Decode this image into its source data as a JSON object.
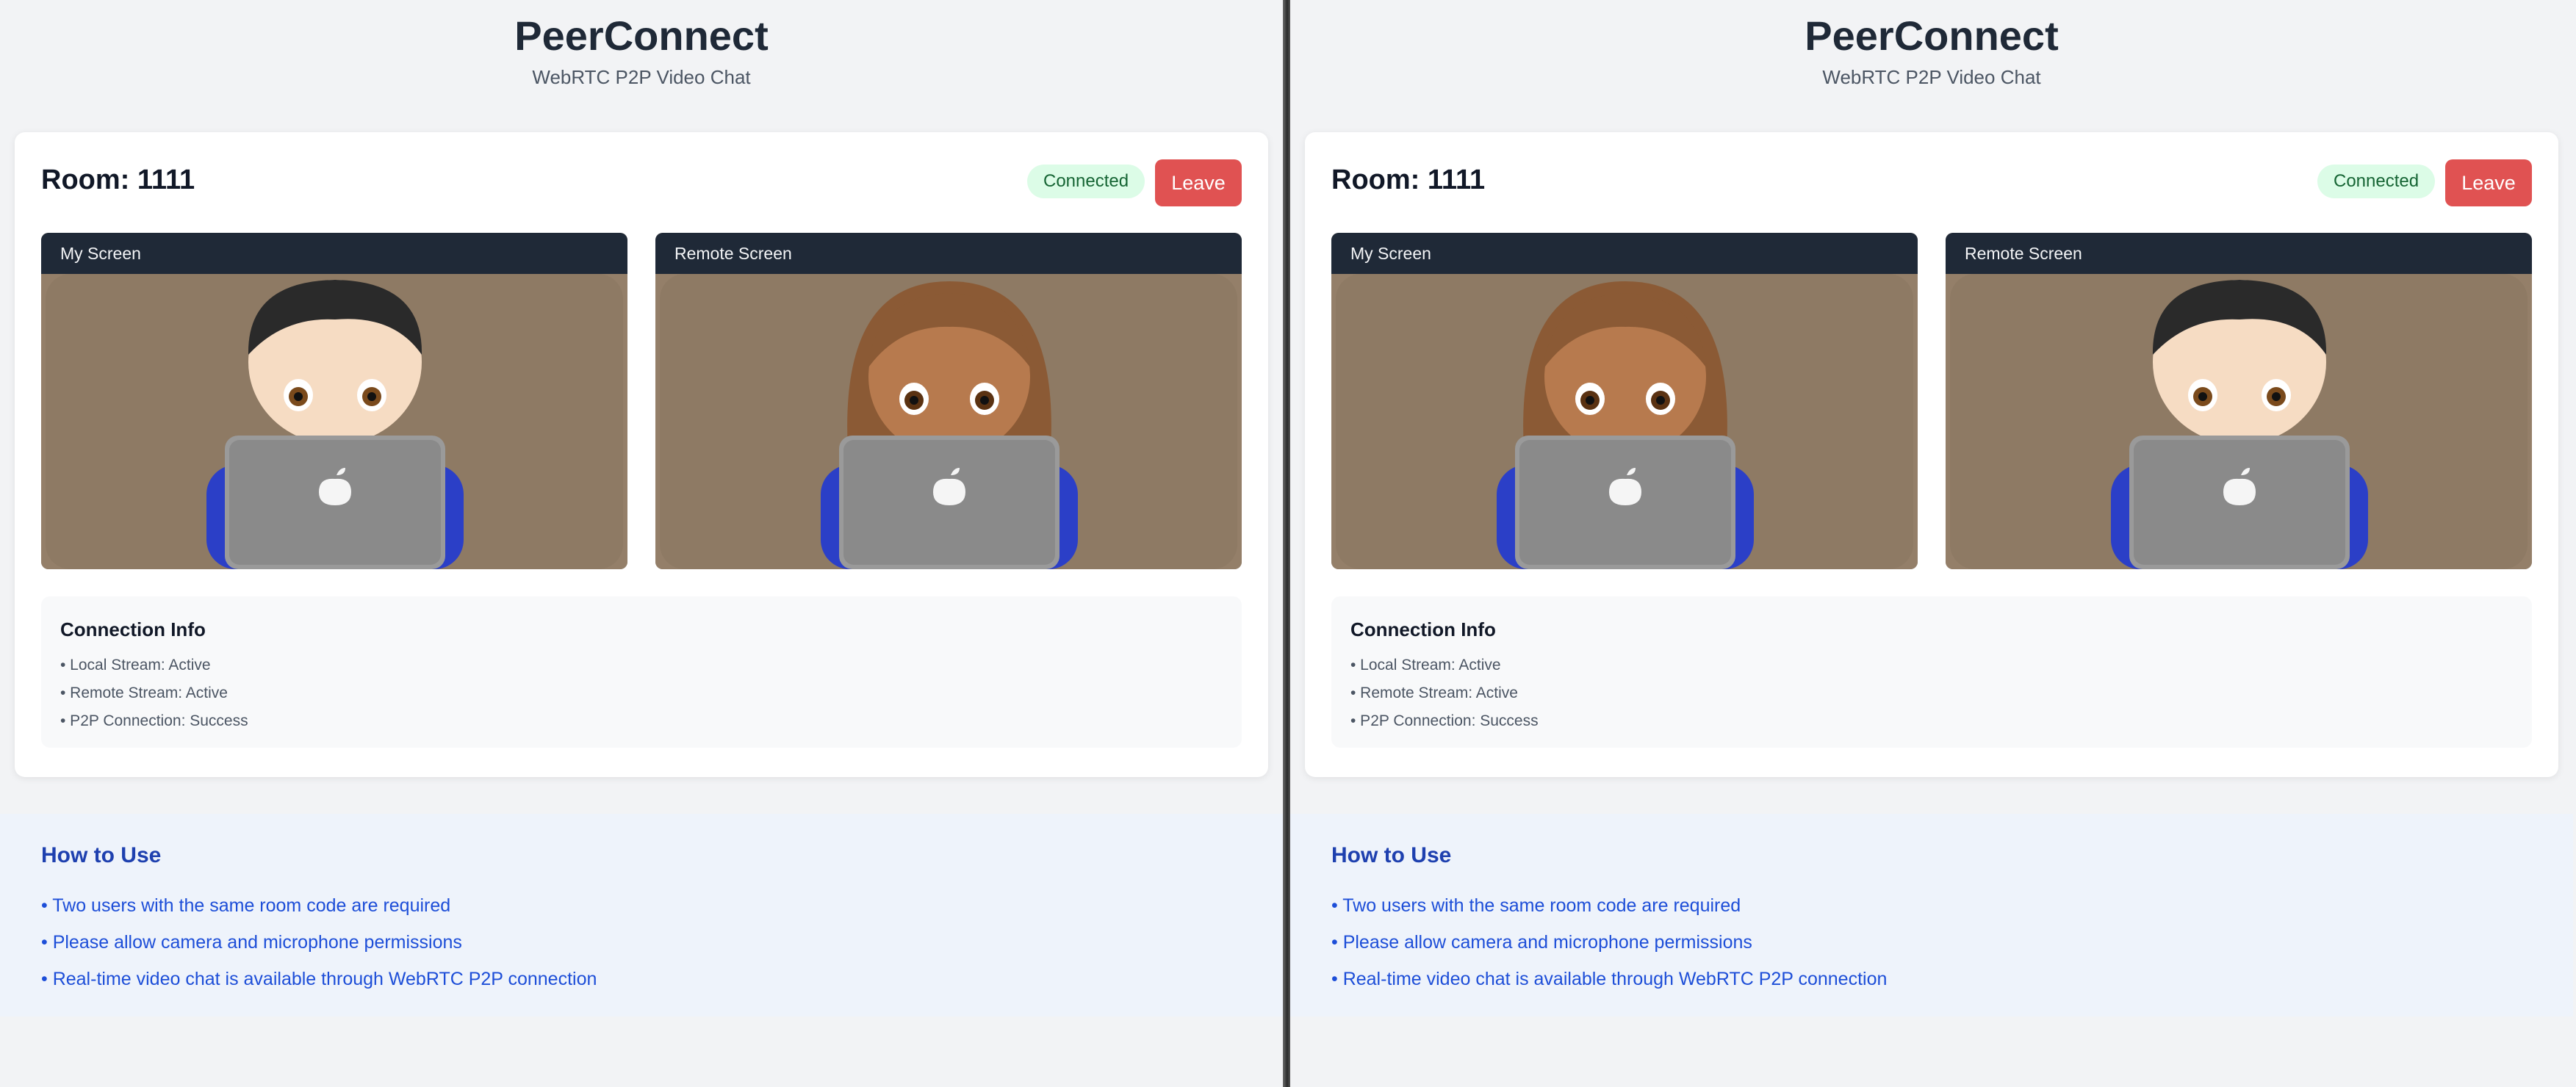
{
  "app": {
    "title": "PeerConnect",
    "tagline": "WebRTC P2P Video Chat"
  },
  "colors": {
    "connected_bg": "#dcfce7",
    "leave": "#e05252",
    "help_text": "#1d4ed8"
  },
  "panes": [
    {
      "room_title": "Room: 1111",
      "status": "Connected",
      "leave_label": "Leave",
      "my_screen_label": "My Screen",
      "remote_screen_label": "Remote Screen",
      "my_avatar": "boy-with-laptop",
      "remote_avatar": "girl-with-laptop",
      "info": {
        "title": "Connection Info",
        "lines": [
          "• Local Stream: Active",
          "• Remote Stream: Active",
          "• P2P Connection: Success"
        ]
      },
      "help": {
        "title": "How to Use",
        "lines": [
          "• Two users with the same room code are required",
          "• Please allow camera and microphone permissions",
          "• Real-time video chat is available through WebRTC P2P connection"
        ]
      }
    },
    {
      "room_title": "Room: 1111",
      "status": "Connected",
      "leave_label": "Leave",
      "my_screen_label": "My Screen",
      "remote_screen_label": "Remote Screen",
      "my_avatar": "girl-with-laptop",
      "remote_avatar": "boy-with-laptop",
      "info": {
        "title": "Connection Info",
        "lines": [
          "• Local Stream: Active",
          "• Remote Stream: Active",
          "• P2P Connection: Success"
        ]
      },
      "help": {
        "title": "How to Use",
        "lines": [
          "• Two users with the same room code are required",
          "• Please allow camera and microphone permissions",
          "• Real-time video chat is available through WebRTC P2P connection"
        ]
      }
    }
  ]
}
